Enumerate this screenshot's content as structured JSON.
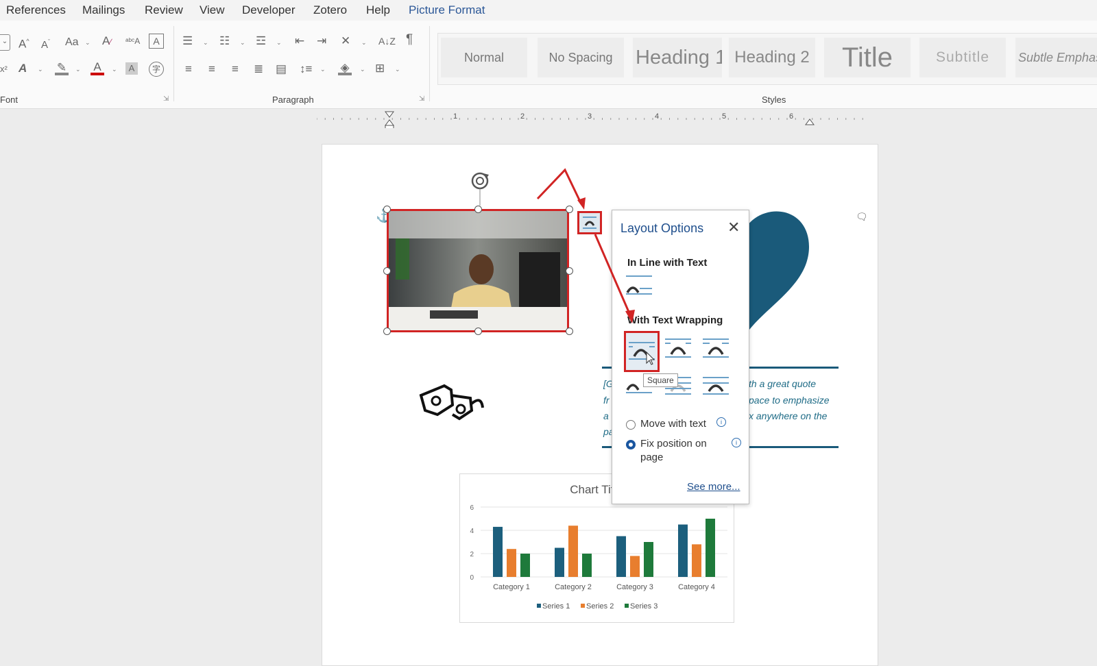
{
  "menu": {
    "tabs": [
      "References",
      "Mailings",
      "Review",
      "View",
      "Developer",
      "Zotero",
      "Help",
      "Picture Format"
    ]
  },
  "ribbon": {
    "font_group_label": "Font",
    "paragraph_group_label": "Paragraph",
    "styles_group_label": "Styles",
    "styles": [
      "Normal",
      "No Spacing",
      "Heading 1",
      "Heading 2",
      "Title",
      "Subtitle",
      "Subtle Emphasis"
    ]
  },
  "ruler": {
    "numbers": [
      "1",
      "2",
      "3",
      "4",
      "5",
      "6"
    ]
  },
  "document": {
    "quote_lines": [
      "[G",
      "th a great quote",
      "fr",
      "pace to emphasize",
      "a",
      "x anywhere on the",
      "pa"
    ]
  },
  "layout_popup": {
    "title": "Layout Options",
    "inline_heading": "In Line with Text",
    "wrapping_heading": "With Text Wrapping",
    "tooltip": "Square",
    "move_with_text": "Move with text",
    "fix_position": "Fix position on",
    "fix_position_2": "page",
    "see_more": "See more..."
  },
  "chart_data": {
    "type": "bar",
    "title": "Chart Title",
    "categories": [
      "Category 1",
      "Category 2",
      "Category 3",
      "Category 4"
    ],
    "series": [
      {
        "name": "Series 1",
        "values": [
          4.3,
          2.5,
          3.5,
          4.5
        ]
      },
      {
        "name": "Series 2",
        "values": [
          2.4,
          4.4,
          1.8,
          2.8
        ]
      },
      {
        "name": "Series 3",
        "values": [
          2.0,
          2.0,
          3.0,
          5.0
        ]
      }
    ],
    "ylim": [
      0,
      6
    ],
    "yticks": [
      "0",
      "2",
      "4",
      "6"
    ],
    "legend": "bottom",
    "colors": [
      "#1c5f7d",
      "#e87e2e",
      "#1e7a3b"
    ]
  }
}
